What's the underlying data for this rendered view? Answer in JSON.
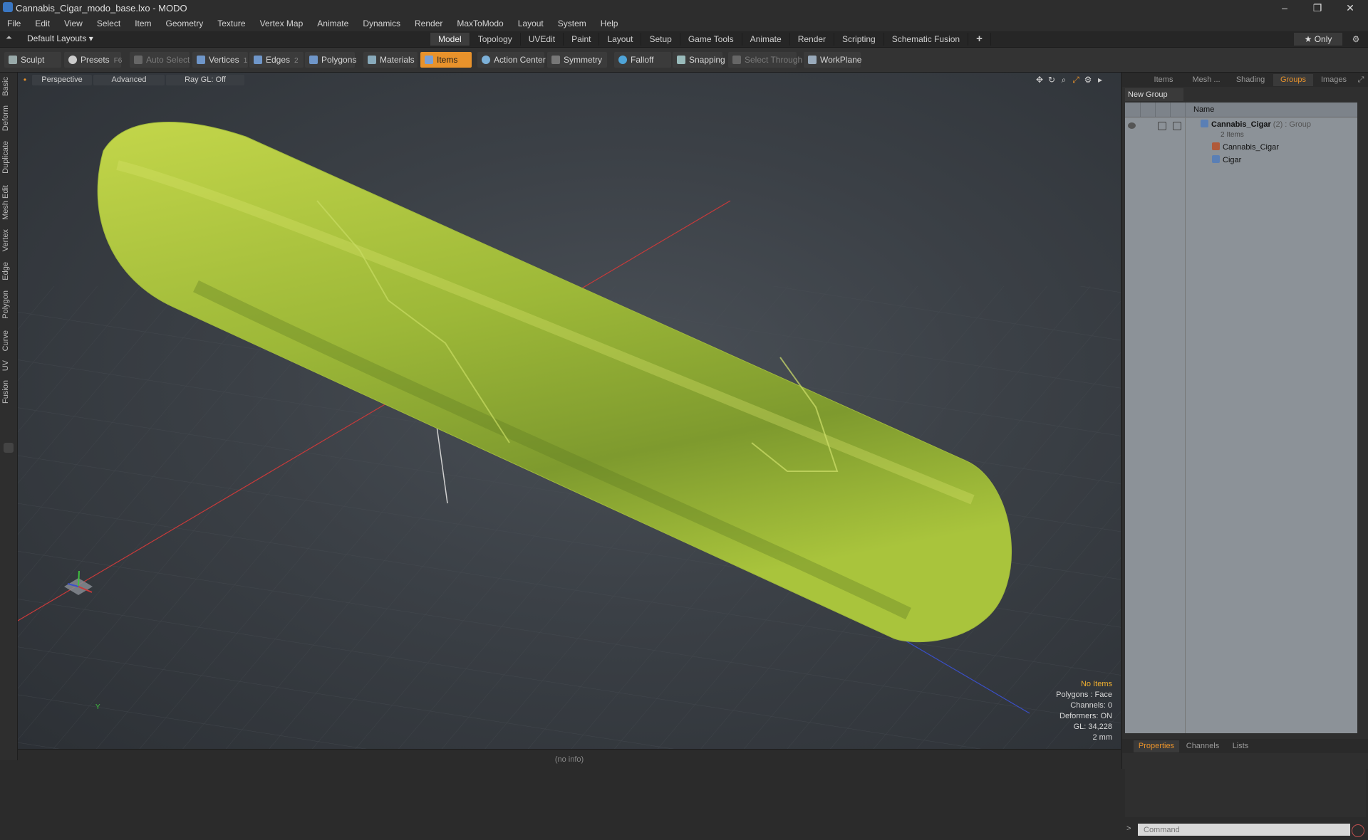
{
  "window": {
    "title": "Cannabis_Cigar_modo_base.lxo - MODO",
    "minimize": "–",
    "restore": "❐",
    "close": "✕"
  },
  "menu": [
    "File",
    "Edit",
    "View",
    "Select",
    "Item",
    "Geometry",
    "Texture",
    "Vertex Map",
    "Animate",
    "Dynamics",
    "Render",
    "MaxToModo",
    "Layout",
    "System",
    "Help"
  ],
  "layout_bar": {
    "layout_select": "Default Layouts ▾",
    "tabs": [
      "Model",
      "Topology",
      "UVEdit",
      "Paint",
      "Layout",
      "Setup",
      "Game Tools",
      "Animate",
      "Render",
      "Scripting",
      "Schematic Fusion"
    ],
    "active_tab": "Model",
    "add": "+",
    "only_label": "★  Only",
    "gear": "⚙"
  },
  "toolbar": {
    "sculpt": "Sculpt",
    "presets": "Presets",
    "presets_key": "F6",
    "auto_select": "Auto Select",
    "vertices": "Vertices",
    "vertices_count": "1",
    "edges": "Edges",
    "edges_count": "2",
    "polygons": "Polygons",
    "materials": "Materials",
    "items": "Items",
    "action_center": "Action Center",
    "symmetry": "Symmetry",
    "falloff": "Falloff",
    "snapping": "Snapping",
    "select_through": "Select Through",
    "workplane": "WorkPlane"
  },
  "left_tabs": [
    "Basic",
    "Deform",
    "Duplicate",
    "Mesh Edit",
    "Vertex",
    "Edge",
    "Polygon",
    "Curve",
    "UV",
    "Fusion"
  ],
  "viewport": {
    "view": "Perspective",
    "advanced": "Advanced",
    "raygl": "Ray GL: Off",
    "info": {
      "selection": "No Items",
      "polygons": "Polygons : Face",
      "channels": "Channels: 0",
      "deformers": "Deformers: ON",
      "gl": "GL: 34,228",
      "unit": "2 mm"
    },
    "axis_y": "Y"
  },
  "status": "(no info)",
  "right_panel": {
    "tabs": [
      "Items",
      "Mesh ...",
      "Shading",
      "Groups",
      "Images"
    ],
    "active_tab": "Groups",
    "new_group": "New Group",
    "column_name": "Name",
    "tree": {
      "group_name": "Cannabis_Cigar",
      "group_suffix": " (2) : Group",
      "group_count": "2 Items",
      "child1": "Cannabis_Cigar",
      "child2": "Cigar"
    },
    "bottom_tabs": [
      "Properties",
      "Channels",
      "Lists"
    ],
    "bottom_active": "Properties",
    "command_placeholder": "Command"
  },
  "colors": {
    "accent": "#e8922b",
    "cigar_light": "#b8cf3e",
    "cigar_dark": "#6f8a2a",
    "axis_x": "#c83a3a",
    "axis_z": "#3a4fc8"
  }
}
